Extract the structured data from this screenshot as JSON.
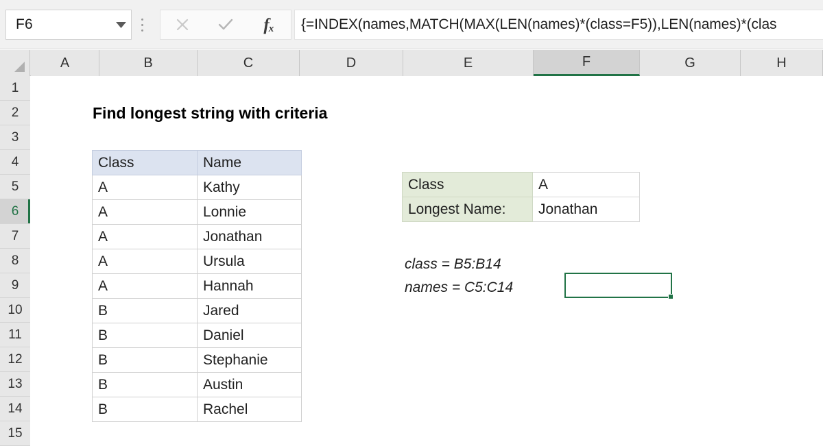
{
  "formula_bar": {
    "name_box_value": "F6",
    "name_box_icon": "chevron-down-icon",
    "cancel_icon": "close-icon",
    "confirm_icon": "check-icon",
    "function_icon": "fx-icon",
    "formula": "{=INDEX(names,MATCH(MAX(LEN(names)*(class=F5)),LEN(names)*(clas"
  },
  "grid": {
    "columns": [
      "A",
      "B",
      "C",
      "D",
      "E",
      "F",
      "G",
      "H"
    ],
    "active_column": "F",
    "rows": [
      "1",
      "2",
      "3",
      "4",
      "5",
      "6",
      "7",
      "8",
      "9",
      "10",
      "11",
      "12",
      "13",
      "14",
      "15"
    ],
    "active_row": "6",
    "accent_color": "#217346"
  },
  "sheet": {
    "title": "Find longest string with criteria",
    "table": {
      "headers": [
        "Class",
        "Name"
      ],
      "header_fill": "#dce3f0",
      "rows": [
        [
          "A",
          "Kathy"
        ],
        [
          "A",
          "Lonnie"
        ],
        [
          "A",
          "Jonathan"
        ],
        [
          "A",
          "Ursula"
        ],
        [
          "A",
          "Hannah"
        ],
        [
          "B",
          "Jared"
        ],
        [
          "B",
          "Daniel"
        ],
        [
          "B",
          "Stephanie"
        ],
        [
          "B",
          "Austin"
        ],
        [
          "B",
          "Rachel"
        ]
      ]
    },
    "result": {
      "label_fill": "#e3ebd9",
      "rows": [
        {
          "label": "Class",
          "value": "A"
        },
        {
          "label": "Longest Name:",
          "value": "Jonathan"
        }
      ]
    },
    "notes": [
      "class = B5:B14",
      "names = C5:C14"
    ]
  }
}
